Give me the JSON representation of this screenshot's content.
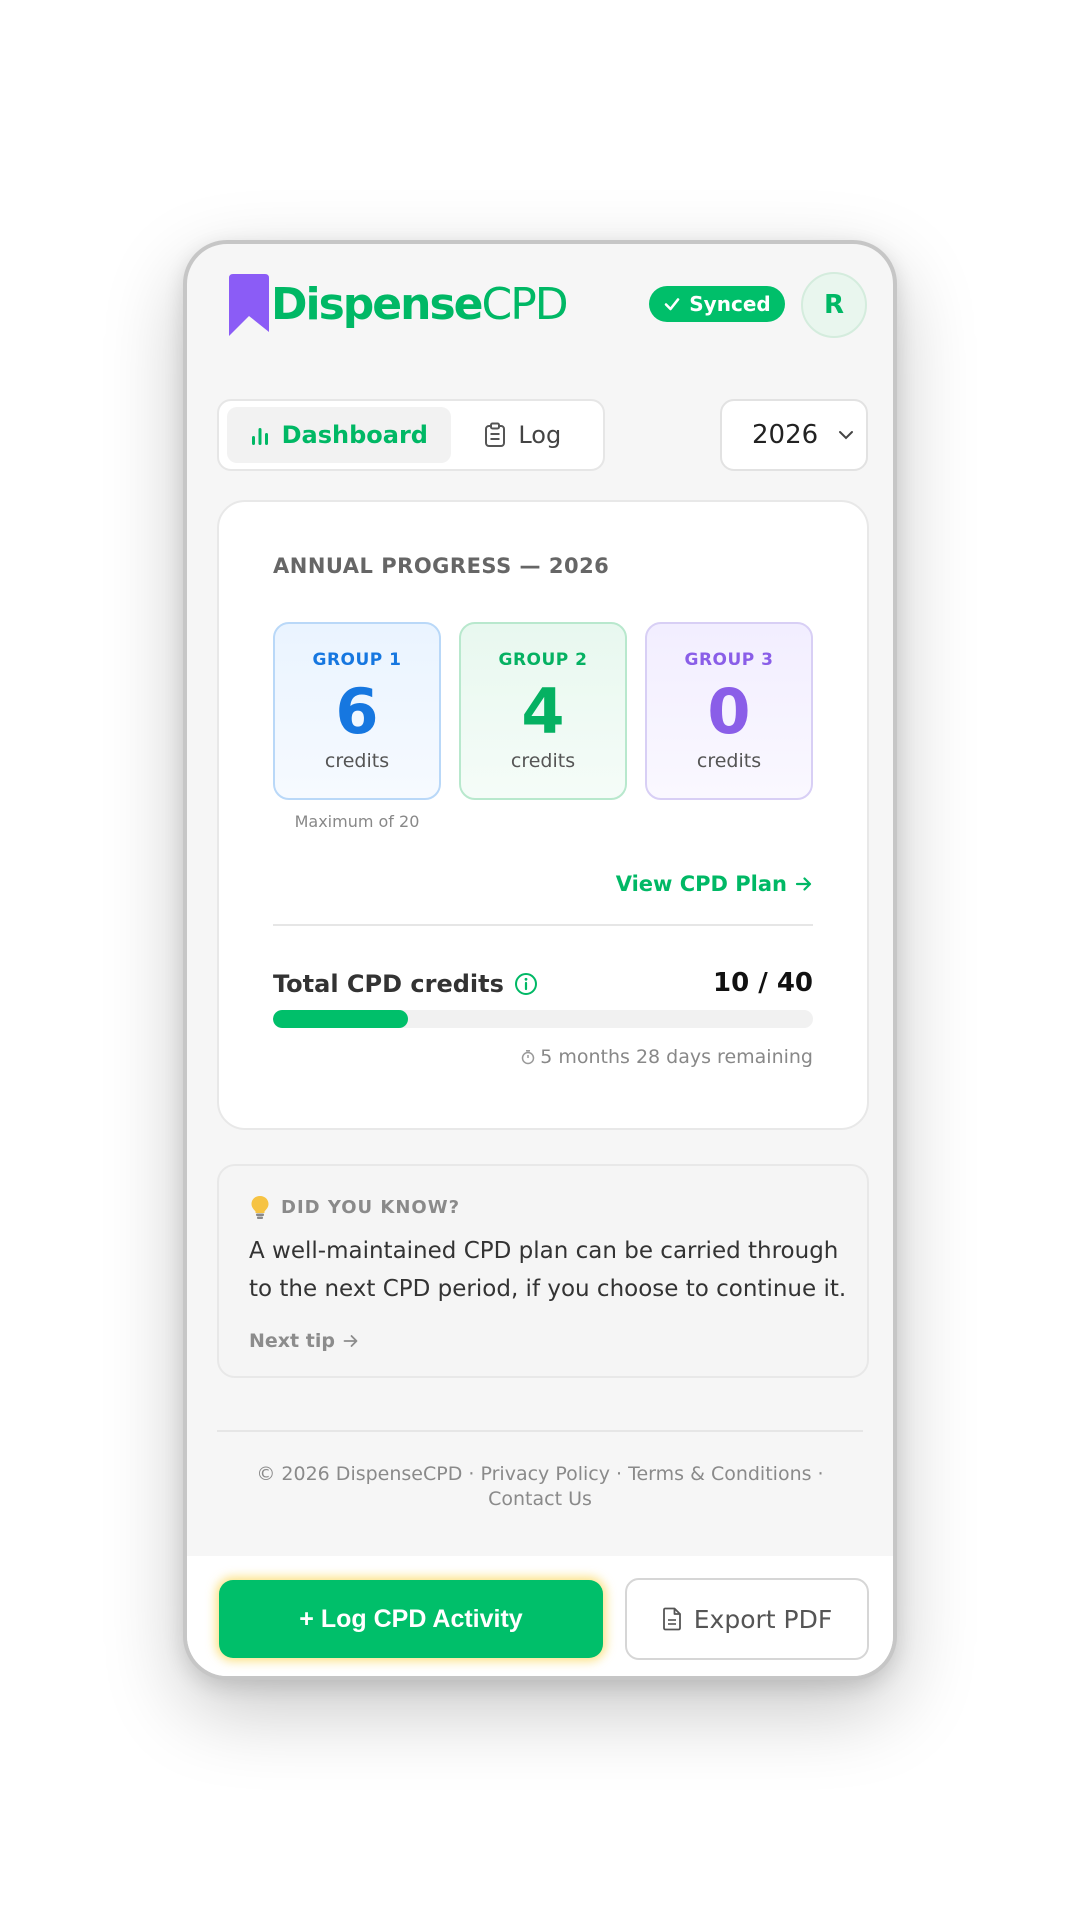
{
  "header": {
    "logo_part1": "Dispense",
    "logo_part2": "CPD",
    "sync_status": "Synced",
    "avatar_initial": "R"
  },
  "tabs": [
    {
      "label": "Dashboard",
      "icon": "bar-chart-icon",
      "active": true
    },
    {
      "label": "Log",
      "icon": "clipboard-icon",
      "active": false
    }
  ],
  "year_select": {
    "value": "2026"
  },
  "progress": {
    "title": "ANNUAL PROGRESS — 2026",
    "groups": [
      {
        "label": "GROUP 1",
        "value": "6",
        "unit": "credits",
        "note": "Maximum of 20",
        "color": "#1677e0"
      },
      {
        "label": "GROUP 2",
        "value": "4",
        "unit": "credits",
        "color": "#05b162"
      },
      {
        "label": "GROUP 3",
        "value": "0",
        "unit": "credits",
        "color": "#8a5ee8"
      }
    ],
    "view_plan_link": "View CPD Plan",
    "total_label": "Total CPD credits",
    "total_value": "10 / 40",
    "total_fraction": 0.25,
    "remaining": "5 months 28 days remaining"
  },
  "tip": {
    "heading": "DID YOU KNOW?",
    "body": "A well-maintained CPD plan can be carried through to the next CPD period, if you choose to continue it.",
    "next_label": "Next tip"
  },
  "footer": {
    "copyright": "© 2026 DispenseCPD",
    "links": [
      "Privacy Policy",
      "Terms & Conditions",
      "Contact Us"
    ]
  },
  "actions": {
    "primary": "+ Log CPD Activity",
    "secondary": "Export PDF"
  },
  "colors": {
    "accent": "#00bf6a",
    "brand_purple": "#8a5ee8"
  }
}
